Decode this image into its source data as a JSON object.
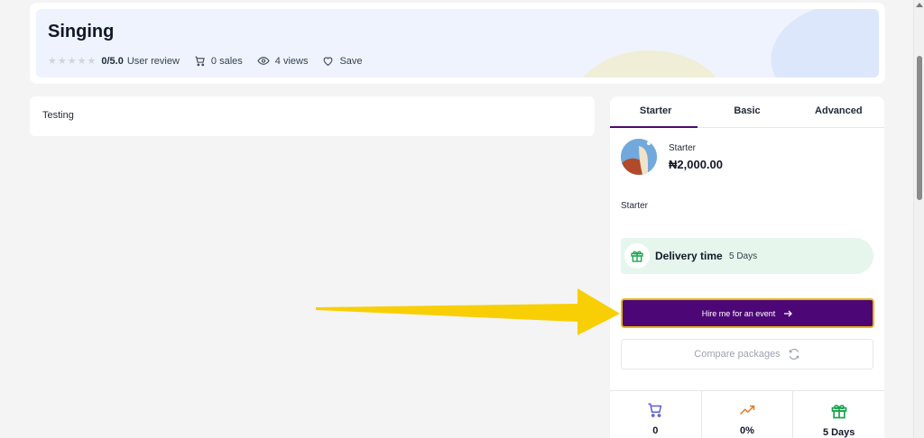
{
  "header": {
    "title": "Singing",
    "rating": "0/5.0",
    "rating_label": "User review",
    "sales": "0 sales",
    "views": "4 views",
    "save": "Save"
  },
  "description": {
    "text": "Testing"
  },
  "packages": {
    "tabs": [
      "Starter",
      "Basic",
      "Advanced"
    ],
    "active_tab": "Starter",
    "name": "Starter",
    "price": "₦2,000.00",
    "desc": "Starter",
    "delivery_label": "Delivery time",
    "delivery_value": "5 Days",
    "hire_button": "Hire me for an event",
    "compare_button": "Compare packages",
    "stats": [
      {
        "icon": "cart-icon",
        "value": "0"
      },
      {
        "icon": "trend-up-icon",
        "value": "0%"
      },
      {
        "icon": "gift-icon",
        "value": "5 Days"
      }
    ]
  },
  "colors": {
    "primary": "#4d0676",
    "accent_yellow": "#f5c800",
    "delivery_bg": "#e6f6ec"
  }
}
